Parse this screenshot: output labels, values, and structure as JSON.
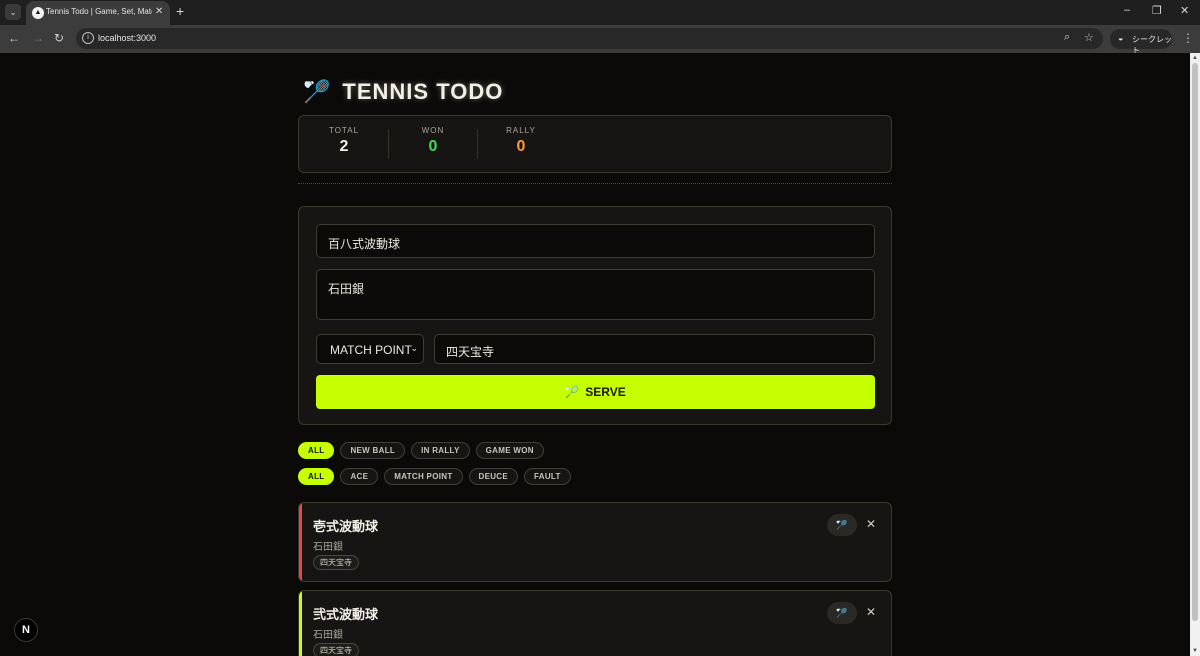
{
  "browser": {
    "tab_title": "Tennis Todo | Game, Set, Match",
    "tab_close": "✕",
    "new_tab": "+",
    "url": "localhost:3000",
    "incognito_label": "シークレット",
    "win_min": "–",
    "win_restore": "❐",
    "win_close": "✕"
  },
  "header": {
    "logo_icon": "🏸",
    "title": "TENNIS TODO"
  },
  "stats": [
    {
      "label": "TOTAL",
      "value": "2",
      "color": "#f4f1e8"
    },
    {
      "label": "WON",
      "value": "0",
      "color": "#3ddc57"
    },
    {
      "label": "RALLY",
      "value": "0",
      "color": "#ff9a2e"
    }
  ],
  "form": {
    "title_value": "百八式波動球",
    "description_value": "石田銀",
    "priority_value": "MATCH POINT",
    "tag_value": "四天宝寺",
    "submit_label": "SERVE",
    "submit_icon": "🏸"
  },
  "status_filters": [
    {
      "label": "ALL",
      "active": true
    },
    {
      "label": "NEW BALL",
      "active": false
    },
    {
      "label": "IN RALLY",
      "active": false
    },
    {
      "label": "GAME WON",
      "active": false
    }
  ],
  "priority_filters": [
    {
      "label": "ALL",
      "active": true
    },
    {
      "label": "ACE",
      "active": false
    },
    {
      "label": "MATCH POINT",
      "active": false
    },
    {
      "label": "DEUCE",
      "active": false
    },
    {
      "label": "FAULT",
      "active": false
    }
  ],
  "todos": [
    {
      "title": "壱式波動球",
      "description": "石田銀",
      "tag": "四天宝寺",
      "stripe_color": "#e8474a"
    },
    {
      "title": "弐式波動球",
      "description": "石田銀",
      "tag": "四天宝寺",
      "stripe_color": "#c6ff00"
    }
  ],
  "dev_badge": "N",
  "colors": {
    "accent": "#c6ff00",
    "background": "#0b0a09",
    "card": "#161513"
  }
}
